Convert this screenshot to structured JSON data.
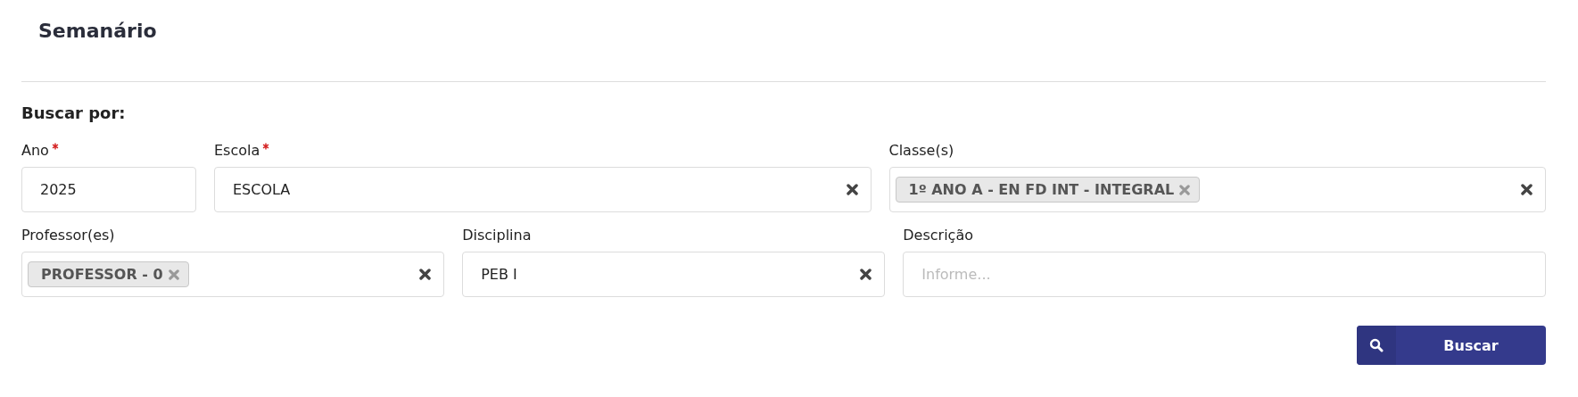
{
  "title": "Semanário",
  "section_label": "Buscar por:",
  "rows": [
    [
      {
        "label": "Ano",
        "required": true,
        "kind": "input",
        "value": "2025"
      },
      {
        "label": "Escola",
        "required": true,
        "kind": "select",
        "value": "ESCOLA"
      },
      {
        "label": "Classe(s)",
        "required": false,
        "kind": "multiselect",
        "tags": [
          "1º ANO A - EN FD INT - INTEGRAL"
        ]
      }
    ],
    [
      {
        "label": "Professor(es)",
        "required": false,
        "kind": "multiselect",
        "tags": [
          "PROFESSOR - 0"
        ]
      },
      {
        "label": "Disciplina",
        "required": false,
        "kind": "select",
        "value": "PEB I"
      },
      {
        "label": "Descrição",
        "required": false,
        "kind": "input",
        "placeholder": "Informe..."
      }
    ]
  ],
  "search_button": {
    "label": "Buscar"
  }
}
